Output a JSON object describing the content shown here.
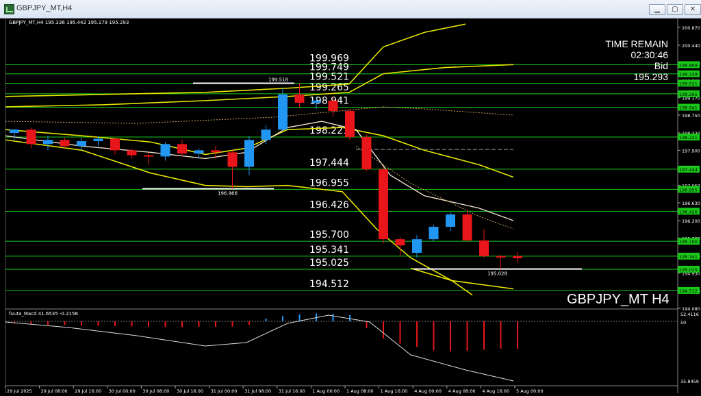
{
  "window": {
    "title": "GBPJPY_MT,H4",
    "min_label": "▁",
    "max_label": "▢",
    "close_label": "✕"
  },
  "header": {
    "symbol_line": "GBPJPY_MT,H4  195.336 195.442 195.179 195.293"
  },
  "info": {
    "time_remain_label": "TIME REMAIN",
    "time_remain_value": "02:30:46",
    "bid_label": "Bid",
    "bid_value": "195.293"
  },
  "symbol_watermark": "GBPJPY_MT H4",
  "macd_header": "fuuta_Macd 41.6535  -0.2156",
  "price_axis": {
    "ticks": [
      "200.870",
      "200.440",
      "200.010",
      "199.590",
      "199.170",
      "198.750",
      "198.320",
      "197.900",
      "197.050",
      "196.630",
      "196.200",
      "195.780",
      "195.350",
      "194.930",
      "194.510",
      "194.080"
    ],
    "macd_ticks": [
      "52.4116",
      "50",
      "35.8459"
    ]
  },
  "levels": [
    {
      "value": "199.969",
      "label": "199.969"
    },
    {
      "value": "199.749",
      "label": "199.749"
    },
    {
      "value": "199.521",
      "label": "199.521"
    },
    {
      "value": "199.265",
      "label": "199.265"
    },
    {
      "value": "198.941",
      "label": "198.941"
    },
    {
      "value": "198.221",
      "label": "198.221"
    },
    {
      "value": "197.444",
      "label": "197.444"
    },
    {
      "value": "196.955",
      "label": "196.955"
    },
    {
      "value": "196.426",
      "label": "196.426"
    },
    {
      "value": "195.700",
      "label": "195.700"
    },
    {
      "value": "195.341",
      "label": "195.341"
    },
    {
      "value": "195.025",
      "label": "195.025"
    },
    {
      "value": "194.512",
      "label": "194.512"
    }
  ],
  "annotations": {
    "high_label": "199.518",
    "low_label": "196.966",
    "last_low_label": "195.028"
  },
  "time_axis": [
    "29 Jul 2025",
    "29 Jul 08:00",
    "29 Jul 16:00",
    "30 Jul 00:00",
    "30 Jul 08:00",
    "30 Jul 16:00",
    "31 Jul 00:00",
    "31 Jul 08:00",
    "31 Jul 16:00",
    "1 Aug 00:00",
    "1 Aug 08:00",
    "1 Aug 16:00",
    "4 Aug 00:00",
    "4 Aug 08:00",
    "4 Aug 16:00",
    "5 Aug 00:00"
  ],
  "colors": {
    "bull": "#2196f3",
    "bear": "#e8161b",
    "level": "#19c819",
    "band": "#e6e600",
    "ma": "#f0e0d0",
    "bg": "#000000"
  },
  "candles": [
    {
      "o": 198.32,
      "h": 198.42,
      "l": 198.15,
      "c": 198.4
    },
    {
      "o": 198.4,
      "h": 198.45,
      "l": 197.95,
      "c": 198.05
    },
    {
      "o": 198.05,
      "h": 198.25,
      "l": 197.9,
      "c": 198.15
    },
    {
      "o": 198.15,
      "h": 198.2,
      "l": 197.95,
      "c": 198.0
    },
    {
      "o": 198.0,
      "h": 198.2,
      "l": 197.9,
      "c": 198.12
    },
    {
      "o": 198.12,
      "h": 198.25,
      "l": 198.0,
      "c": 198.18
    },
    {
      "o": 198.18,
      "h": 198.2,
      "l": 197.8,
      "c": 197.9
    },
    {
      "o": 197.9,
      "h": 197.95,
      "l": 197.7,
      "c": 197.78
    },
    {
      "o": 197.78,
      "h": 197.85,
      "l": 197.55,
      "c": 197.75
    },
    {
      "o": 197.75,
      "h": 198.1,
      "l": 197.65,
      "c": 198.05
    },
    {
      "o": 198.05,
      "h": 198.15,
      "l": 197.75,
      "c": 197.82
    },
    {
      "o": 197.82,
      "h": 197.95,
      "l": 197.7,
      "c": 197.9
    },
    {
      "o": 197.9,
      "h": 198.0,
      "l": 197.7,
      "c": 197.85
    },
    {
      "o": 197.85,
      "h": 197.9,
      "l": 196.97,
      "c": 197.5
    },
    {
      "o": 197.5,
      "h": 198.25,
      "l": 197.3,
      "c": 198.15
    },
    {
      "o": 198.15,
      "h": 198.5,
      "l": 198.05,
      "c": 198.4
    },
    {
      "o": 198.4,
      "h": 199.4,
      "l": 198.35,
      "c": 199.25
    },
    {
      "o": 199.25,
      "h": 199.52,
      "l": 198.95,
      "c": 199.05
    },
    {
      "o": 199.05,
      "h": 199.2,
      "l": 198.9,
      "c": 199.1
    },
    {
      "o": 199.1,
      "h": 199.2,
      "l": 198.7,
      "c": 198.85
    },
    {
      "o": 198.85,
      "h": 198.9,
      "l": 198.15,
      "c": 198.22
    },
    {
      "o": 198.22,
      "h": 198.28,
      "l": 197.4,
      "c": 197.44
    },
    {
      "o": 197.44,
      "h": 197.5,
      "l": 195.65,
      "c": 195.75
    },
    {
      "o": 195.75,
      "h": 195.8,
      "l": 195.35,
      "c": 195.6
    },
    {
      "o": 195.42,
      "h": 195.85,
      "l": 195.3,
      "c": 195.75
    },
    {
      "o": 195.75,
      "h": 196.1,
      "l": 195.7,
      "c": 196.05
    },
    {
      "o": 196.05,
      "h": 196.4,
      "l": 195.95,
      "c": 196.35
    },
    {
      "o": 196.35,
      "h": 196.45,
      "l": 195.7,
      "c": 195.72
    },
    {
      "o": 195.72,
      "h": 196.0,
      "l": 195.3,
      "c": 195.34
    },
    {
      "o": 195.34,
      "h": 195.38,
      "l": 195.03,
      "c": 195.33
    },
    {
      "o": 195.34,
      "h": 195.44,
      "l": 195.18,
      "c": 195.29
    }
  ],
  "macd_hist": [
    -0.6,
    -0.8,
    -1.0,
    -1.1,
    -1.2,
    -1.3,
    -1.4,
    -1.5,
    -1.6,
    -1.7,
    -1.7,
    -1.6,
    -1.6,
    -1.5,
    -1.0,
    0.8,
    1.5,
    2.0,
    2.3,
    2.2,
    1.8,
    -2.0,
    -5.0,
    -6.5,
    -7.5,
    -8.5,
    -8.8,
    -8.6,
    -8.3,
    -8.0,
    -8.0
  ]
}
